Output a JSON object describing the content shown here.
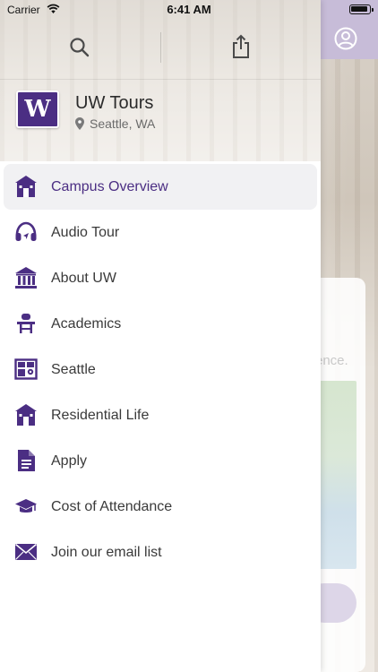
{
  "status_bar": {
    "carrier": "Carrier",
    "time": "6:41 AM"
  },
  "drawer": {
    "app_title": "UW Tours",
    "location": "Seattle, WA",
    "logo_letter": "W",
    "menu": [
      {
        "label": "Campus Overview",
        "icon": "campus-building-icon",
        "active": true
      },
      {
        "label": "Audio Tour",
        "icon": "headphones-icon",
        "active": false
      },
      {
        "label": "About UW",
        "icon": "columns-icon",
        "active": false
      },
      {
        "label": "Academics",
        "icon": "desk-icon",
        "active": false
      },
      {
        "label": "Seattle",
        "icon": "city-map-icon",
        "active": false
      },
      {
        "label": "Residential Life",
        "icon": "residence-icon",
        "active": false
      },
      {
        "label": "Apply",
        "icon": "document-icon",
        "active": false
      },
      {
        "label": "Cost of Attendance",
        "icon": "graduation-cap-icon",
        "active": false
      },
      {
        "label": "Join our email list",
        "icon": "envelope-icon",
        "active": false
      }
    ]
  },
  "background_page": {
    "partial_text": "ence."
  },
  "colors": {
    "accent": "#4b2e83",
    "active_bg": "#f1f1f3",
    "topbar_tint": "#c7bcd8"
  }
}
